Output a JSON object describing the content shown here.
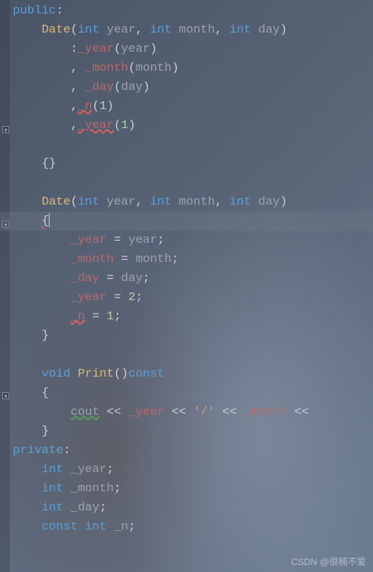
{
  "code": {
    "public_kw": "public",
    "private_kw": "private",
    "colon": ":",
    "int_kw": "int",
    "void_kw": "void",
    "const_kw": "const",
    "class_ctor": "Date",
    "param_year": "year",
    "param_month": "month",
    "param_day": "day",
    "mem_year": "_year",
    "mem_month": "_month",
    "mem_day": "_day",
    "mem_n": "_n",
    "func_print": "Print",
    "cout": "cout",
    "lshift": "<<",
    "slash_char": "'/'",
    "eq": "=",
    "semi": ";",
    "comma": ",",
    "open_paren": "(",
    "close_paren": ")",
    "open_brace": "{",
    "close_brace": "}",
    "empty_braces": "{}",
    "num_1": "1",
    "num_2": "2"
  },
  "watermark": "CSDN @很楠不爱"
}
